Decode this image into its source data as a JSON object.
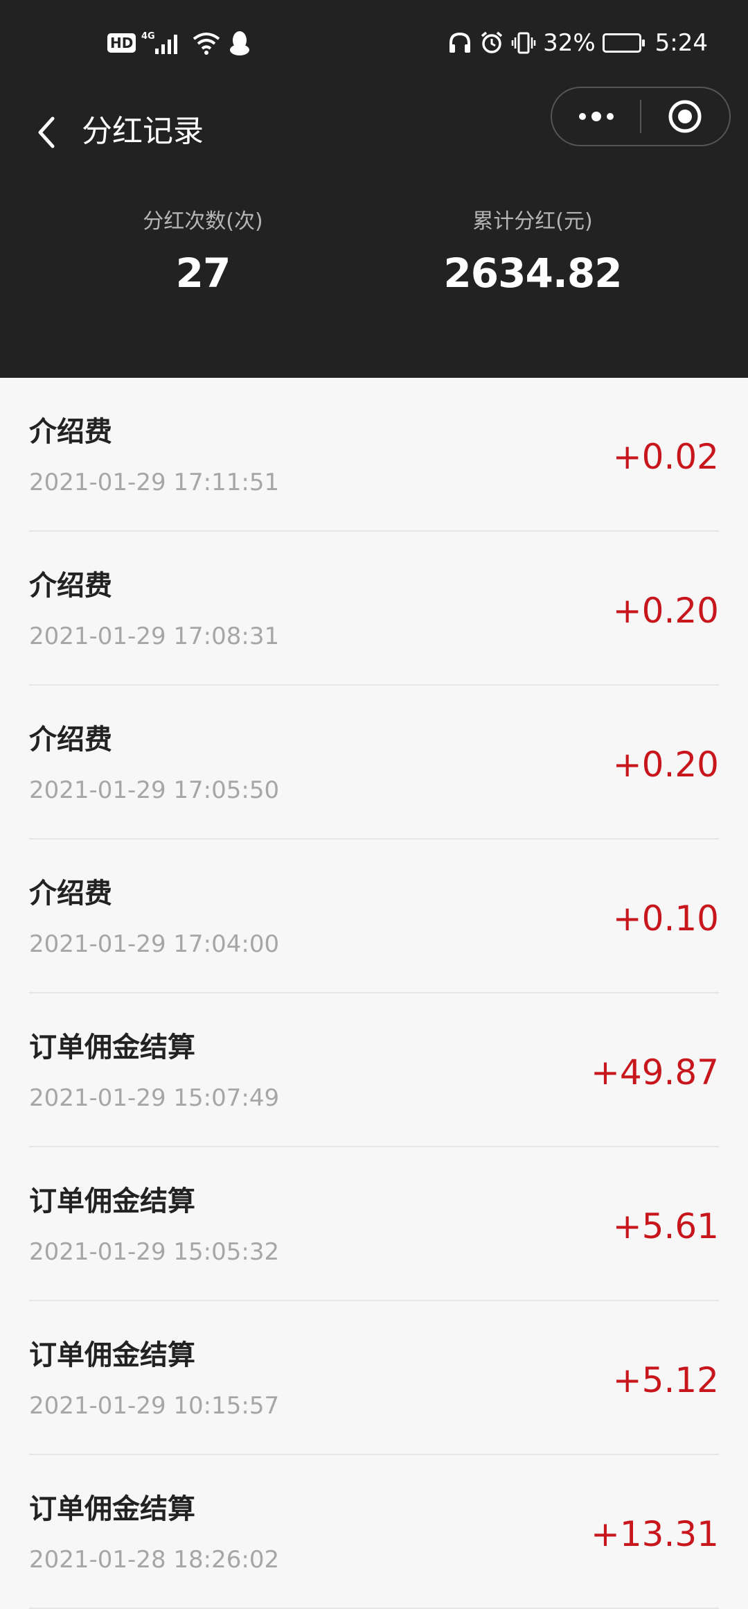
{
  "status_bar": {
    "hd": "HD",
    "network": "4G",
    "battery_percent": "32%",
    "battery_level": 0.32,
    "time": "5:24"
  },
  "nav": {
    "title": "分红记录",
    "icons": {
      "back": "chevron-left-icon",
      "more": "more-dots-icon",
      "close": "target-circle-icon"
    }
  },
  "stats": {
    "count_label": "分红次数(次)",
    "count_value": "27",
    "total_label": "累计分红(元)",
    "total_value": "2634.82"
  },
  "records": [
    {
      "title": "介绍费",
      "time": "2021-01-29 17:11:51",
      "amount": "+0.02"
    },
    {
      "title": "介绍费",
      "time": "2021-01-29 17:08:31",
      "amount": "+0.20"
    },
    {
      "title": "介绍费",
      "time": "2021-01-29 17:05:50",
      "amount": "+0.20"
    },
    {
      "title": "介绍费",
      "time": "2021-01-29 17:04:00",
      "amount": "+0.10"
    },
    {
      "title": "订单佣金结算",
      "time": "2021-01-29 15:07:49",
      "amount": "+49.87"
    },
    {
      "title": "订单佣金结算",
      "time": "2021-01-29 15:05:32",
      "amount": "+5.61"
    },
    {
      "title": "订单佣金结算",
      "time": "2021-01-29 10:15:57",
      "amount": "+5.12"
    },
    {
      "title": "订单佣金结算",
      "time": "2021-01-28 18:26:02",
      "amount": "+13.31"
    }
  ],
  "colors": {
    "header_bg": "#222222",
    "page_bg": "#f7f7f7",
    "amount_red": "#c8161d"
  }
}
